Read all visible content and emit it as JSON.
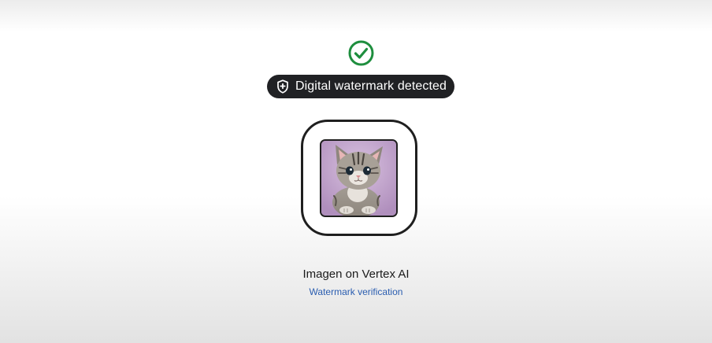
{
  "status": {
    "icon": "check-circle-icon",
    "badge_icon": "shield-plus-icon",
    "badge_text": "Digital watermark detected",
    "success_color": "#1e8e3e"
  },
  "preview": {
    "image": "kitten-photo"
  },
  "footer": {
    "title": "Imagen on Vertex AI",
    "link_text": "Watermark verification",
    "link_color": "#2a5db0"
  }
}
